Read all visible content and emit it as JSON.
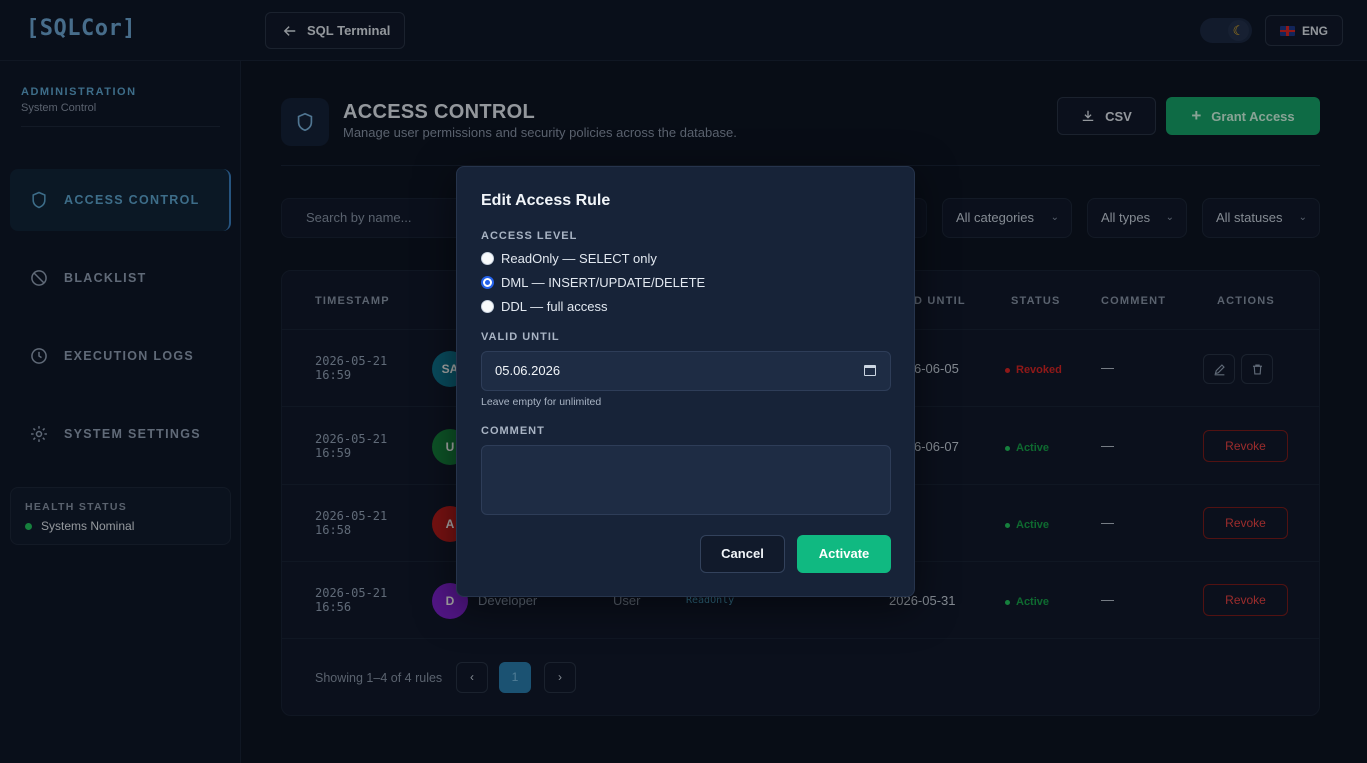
{
  "app": {
    "logo": "[SQLCor]"
  },
  "topbar": {
    "terminal_label": "SQL Terminal",
    "lang_label": "ENG",
    "theme_icon": "☾"
  },
  "sidebar": {
    "section_title": "ADMINISTRATION",
    "section_sub": "System Control",
    "items": [
      {
        "label": "ACCESS CONTROL",
        "icon": "shield-icon",
        "active": true
      },
      {
        "label": "BLACKLIST",
        "icon": "ban-icon",
        "active": false
      },
      {
        "label": "EXECUTION LOGS",
        "icon": "clock-icon",
        "active": false
      },
      {
        "label": "SYSTEM SETTINGS",
        "icon": "gear-icon",
        "active": false
      }
    ],
    "health": {
      "title": "HEALTH STATUS",
      "status": "Systems Nominal"
    }
  },
  "header": {
    "title": "ACCESS CONTROL",
    "subtitle": "Manage user permissions and security policies across the database.",
    "csv_label": "CSV",
    "grant_label": "Grant Access"
  },
  "filters": {
    "search_placeholder": "Search by name...",
    "categories": "All categories",
    "types": "All types",
    "statuses": "All statuses"
  },
  "table": {
    "columns": [
      "TIMESTAMP",
      "D UNTIL",
      "STATUS",
      "COMMENT",
      "ACTIONS"
    ],
    "rows": [
      {
        "ts1": "2026-05-21",
        "ts2": "16:59",
        "initials": "SA",
        "until": "6-06-05",
        "status": "Revoked",
        "comment": "—"
      },
      {
        "ts1": "2026-05-21",
        "ts2": "16:59",
        "initials": "U",
        "until": "6-06-07",
        "status": "Active",
        "comment": "—",
        "action": "Revoke"
      },
      {
        "ts1": "2026-05-21",
        "ts2": "16:58",
        "initials": "A",
        "until": "",
        "status": "Active",
        "comment": "—",
        "action": "Revoke"
      },
      {
        "ts1": "2026-05-21",
        "ts2": "16:56",
        "initials": "D",
        "name": "Developer",
        "type": "User",
        "level": "ReadOnly",
        "until": "2026-05-31",
        "status": "Active",
        "comment": "—",
        "action": "Revoke"
      }
    ],
    "footer": {
      "showing": "Showing 1–4 of 4 rules",
      "page": "1",
      "prev": "‹",
      "next": "›"
    }
  },
  "modal": {
    "title": "Edit Access Rule",
    "access_level_label": "ACCESS LEVEL",
    "options": [
      {
        "label": "ReadOnly — SELECT only",
        "checked": false
      },
      {
        "label": "DML — INSERT/UPDATE/DELETE",
        "checked": true
      },
      {
        "label": "DDL — full access",
        "checked": false
      }
    ],
    "valid_until_label": "VALID UNTIL",
    "valid_until_value": "05.06.2026",
    "valid_until_hint": "Leave empty for unlimited",
    "comment_label": "COMMENT",
    "comment_value": "",
    "cancel_label": "Cancel",
    "activate_label": "Activate"
  },
  "colors": {
    "accent": "#5fa8d3",
    "success": "#10b981",
    "danger": "#ef4444",
    "active_status": "#22c55e",
    "revoked_status": "#dc2626"
  }
}
